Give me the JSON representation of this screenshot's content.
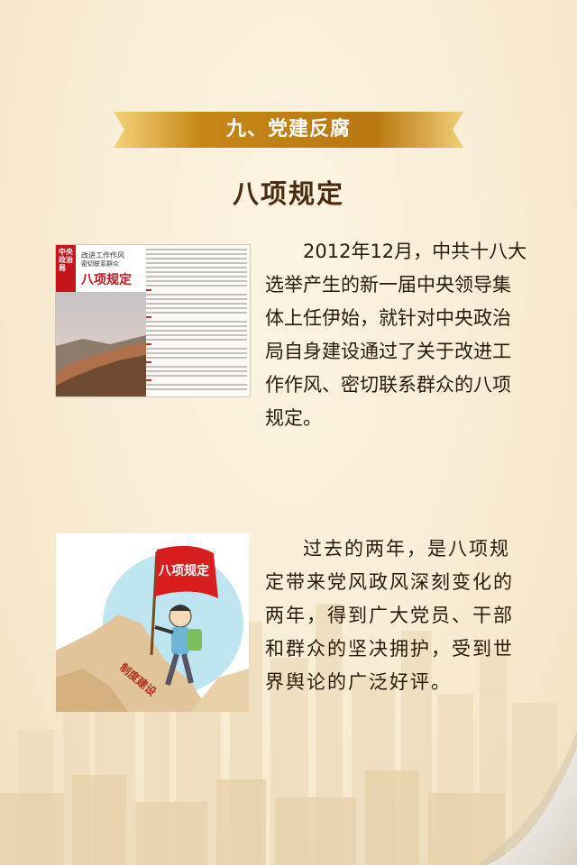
{
  "section": {
    "banner_title": "九、党建反腐"
  },
  "page": {
    "subtitle": "八项规定"
  },
  "newspaper": {
    "side_label": "中央政治局",
    "headline_line1": "改进工作作风",
    "headline_line2": "密切联系群众",
    "headline_main": "八项规定"
  },
  "article": {
    "paragraph1": "2012年12月，中共十八大选举产生的新一届中央领导集体上任伊始，就针对中央政治局自身建设通过了关于改进工作作风、密切联系群众的八项规定。",
    "paragraph2": "过去的两年，是八项规定带来党风政风深刻变化的两年，得到广大党员、干部和群众的坚决拥护，受到世界舆论的广泛好评。"
  },
  "cartoon": {
    "flag_text": "八项规定",
    "mountain_text": "制度建设"
  },
  "colors": {
    "background": "#f8ecd3",
    "banner_gold": "#c98b1c",
    "accent_red": "#c5141a",
    "text_dark": "#2a1a0a"
  }
}
